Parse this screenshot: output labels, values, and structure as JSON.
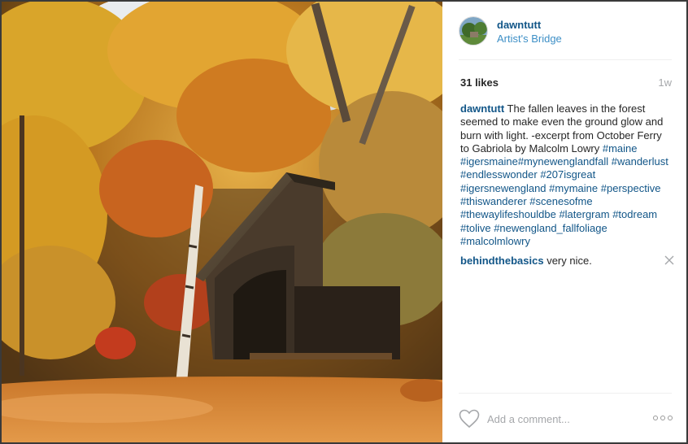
{
  "post": {
    "username": "dawntutt",
    "location": "Artist's Bridge",
    "likes": "31 likes",
    "time_ago": "1w",
    "caption": {
      "author": "dawntutt",
      "text": "The fallen leaves in the forest seemed to make even the ground glow and burn with light. -excerpt from October Ferry to Gabriola by Malcolm Lowry",
      "hashtags": [
        "#maine",
        "#igersmaine",
        "#mynewenglandfall",
        "#wanderlust",
        "#endlesswonder",
        "#207isgreat",
        "#igersnewengland",
        "#mymaine",
        "#perspective",
        "#thiswanderer",
        "#scenesofme",
        "#thewaylifeshouldbe",
        "#latergram",
        "#todream",
        "#tolive",
        "#newengland_fallfoliage",
        "#malcolmlowry"
      ]
    },
    "comments": [
      {
        "author": "behindthebasics",
        "text": "very nice."
      }
    ],
    "comment_placeholder": "Add a comment..."
  },
  "icons": {
    "avatar": "profile-avatar",
    "like": "heart-icon",
    "remove_comment": "close-icon",
    "options": "more-options-icon"
  },
  "colors": {
    "link": "#125688",
    "location": "#3d8fc6",
    "muted": "#a5a7aa"
  }
}
